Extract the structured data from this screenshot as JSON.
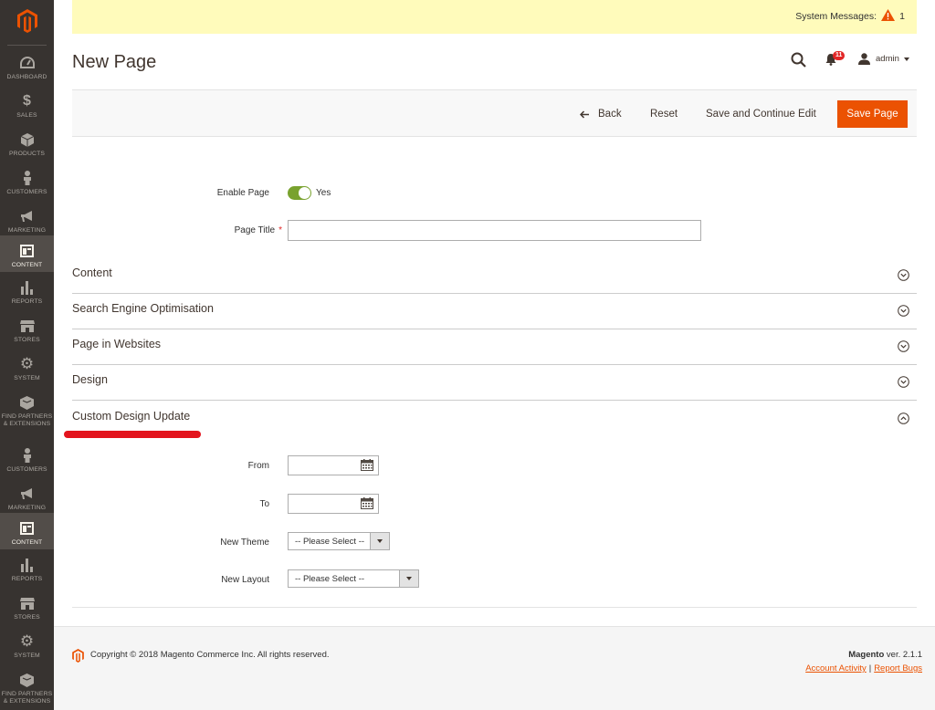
{
  "sidebar": {
    "items": [
      {
        "label": "DASHBOARD",
        "icon": "dashboard-icon"
      },
      {
        "label": "SALES",
        "icon": "dollar-icon"
      },
      {
        "label": "PRODUCTS",
        "icon": "cube-icon"
      },
      {
        "label": "CUSTOMERS",
        "icon": "person-icon"
      },
      {
        "label": "MARKETING",
        "icon": "megaphone-icon"
      },
      {
        "label": "CONTENT",
        "icon": "layout-icon",
        "active": true
      },
      {
        "label": "REPORTS",
        "icon": "bar-chart-icon"
      },
      {
        "label": "STORES",
        "icon": "store-icon"
      },
      {
        "label": "SYSTEM",
        "icon": "gear-icon"
      },
      {
        "label": "FIND PARTNERS & EXTENSIONS",
        "icon": "box-icon"
      },
      {
        "label": "CUSTOMERS",
        "icon": "person-icon"
      },
      {
        "label": "MARKETING",
        "icon": "megaphone-icon"
      },
      {
        "label": "CONTENT",
        "icon": "layout-icon",
        "active": true
      },
      {
        "label": "REPORTS",
        "icon": "bar-chart-icon"
      },
      {
        "label": "STORES",
        "icon": "store-icon"
      },
      {
        "label": "SYSTEM",
        "icon": "gear-icon"
      },
      {
        "label": "FIND PARTNERS & EXTENSIONS",
        "icon": "box-icon"
      }
    ]
  },
  "system_messages": {
    "label": "System Messages:",
    "count": "1"
  },
  "header": {
    "title": "New Page",
    "notifications_count": "11",
    "user": "admin"
  },
  "actions": {
    "back": "Back",
    "reset": "Reset",
    "save_continue": "Save and Continue Edit",
    "save": "Save Page"
  },
  "form": {
    "enable_label": "Enable Page",
    "enable_value": "Yes",
    "page_title_label": "Page Title",
    "page_title_value": ""
  },
  "sections": {
    "content": "Content",
    "seo": "Search Engine Optimisation",
    "websites": "Page in Websites",
    "design": "Design",
    "custom_design": "Custom Design Update"
  },
  "custom_design": {
    "from_label": "From",
    "to_label": "To",
    "theme_label": "New Theme",
    "theme_value": "-- Please Select --",
    "layout_label": "New Layout",
    "layout_value": "-- Please Select --"
  },
  "footer": {
    "copyright": "Copyright © 2018 Magento Commerce Inc. All rights reserved.",
    "brand": "Magento",
    "version": " ver. 2.1.1",
    "account_activity": "Account Activity",
    "separator": "|",
    "report_bugs": "Report Bugs"
  },
  "colors": {
    "sidebar_bg": "#373330",
    "accent": "#eb5202",
    "system_bar": "#fffbbb",
    "toggle_on": "#79a22e",
    "annotation_red": "#e3141d"
  }
}
